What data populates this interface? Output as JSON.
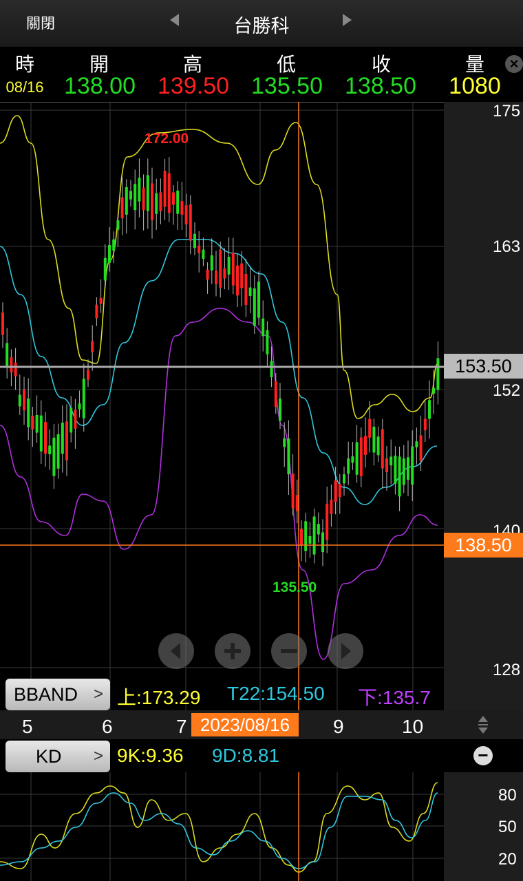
{
  "header": {
    "close_label": "關閉",
    "title": "台勝科"
  },
  "quote": {
    "headers": {
      "time": "時",
      "open": "開",
      "high": "高",
      "low": "低",
      "close": "收",
      "volume": "量"
    },
    "values": {
      "time": "08/16",
      "open": "138.00",
      "high": "139.50",
      "low": "135.50",
      "close": "138.50",
      "volume": "1080"
    }
  },
  "main_chart": {
    "price_axis": [
      "175",
      "163",
      "152",
      "140",
      "128"
    ],
    "current_price_tag": "153.50",
    "crosshair_price_tag": "138.50",
    "high_label": "172.00",
    "low_label": "135.50",
    "x_labels": [
      "5",
      "6",
      "7",
      "9",
      "10"
    ],
    "crosshair_date": "2023/08/16"
  },
  "bband": {
    "name": "BBAND",
    "upper": "上:173.29",
    "mid": "T22:154.50",
    "lower": "下:135.7"
  },
  "kd": {
    "name": "KD",
    "k": "9K:9.36",
    "d": "9D:8.81",
    "axis": [
      "80",
      "50",
      "20"
    ]
  },
  "colors": {
    "up": "#ff2020",
    "down": "#22dd22",
    "upper_band": "#dcdc20",
    "mid_band": "#30c8e0",
    "lower_band": "#b030e0",
    "crosshair": "#ff7a1a"
  },
  "chart_data": {
    "type": "candlestick",
    "title": "台勝科",
    "ylim": [
      128,
      175
    ],
    "x_ticks": [
      "5",
      "6",
      "7",
      "2023/08/16",
      "9",
      "10"
    ],
    "indicators": {
      "BBAND": {
        "upper": 173.29,
        "mid": 154.5,
        "lower": 135.7
      },
      "KD": {
        "K": 9.36,
        "D": 8.81
      }
    },
    "selected_bar": {
      "date": "2023/08/16",
      "open": 138.0,
      "high": 139.5,
      "low": 135.5,
      "close": 138.5,
      "volume": 1080
    },
    "max_label": 172.0,
    "min_label": 135.5,
    "last_price": 153.5
  }
}
